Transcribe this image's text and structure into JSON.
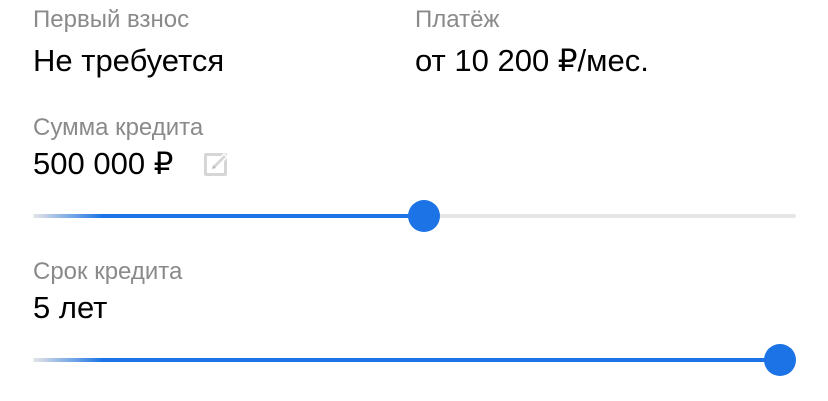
{
  "down_payment": {
    "label": "Первый взнос",
    "value": "Не требуется"
  },
  "payment": {
    "label": "Платёж",
    "value": "от 10 200 ₽/мес."
  },
  "loan_amount": {
    "label": "Сумма кредита",
    "value": "500 000 ₽",
    "edit_icon": "pencil-square-icon",
    "slider_fraction": 0.512
  },
  "loan_term": {
    "label": "Срок кредита",
    "value": "5 лет",
    "slider_fraction": 1.0
  },
  "colors": {
    "accent": "#1b73e6",
    "track": "#e6e6e6",
    "label": "#8a8a8a",
    "value": "#000000",
    "icon": "#d6d6d6"
  }
}
